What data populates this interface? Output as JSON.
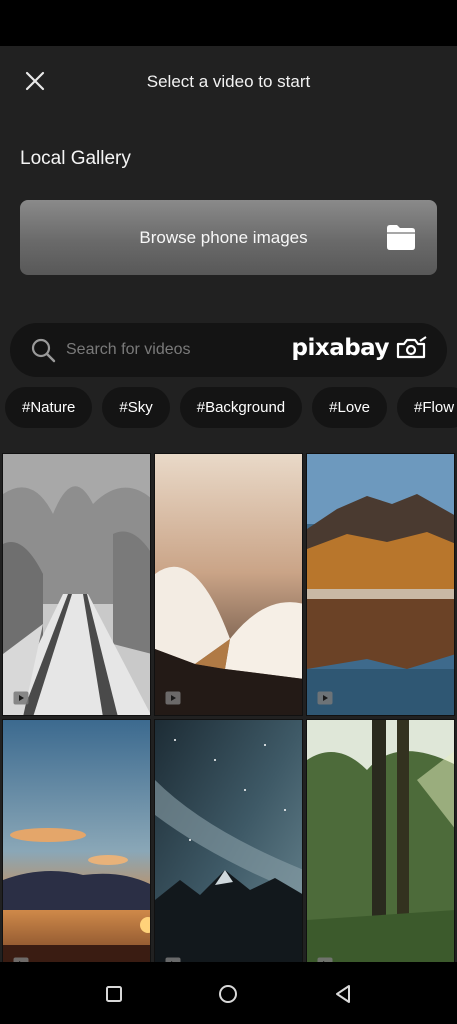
{
  "header": {
    "title": "Select a video to start",
    "close_icon": "close-icon"
  },
  "gallery": {
    "section_title": "Local Gallery",
    "browse_label": "Browse phone images",
    "browse_icon": "folder-icon"
  },
  "search": {
    "placeholder": "Search for videos",
    "brand": "pixabay",
    "search_icon": "search-icon",
    "brand_icon": "camera-icon"
  },
  "tags": [
    "#Nature",
    "#Sky",
    "#Background",
    "#Love",
    "#Flow"
  ],
  "videos": [
    {
      "subject": "snowy forest road",
      "badge_icon": "video-icon"
    },
    {
      "subject": "open book at sunset",
      "badge_icon": "video-icon"
    },
    {
      "subject": "autumn mountain lake",
      "badge_icon": "video-icon"
    },
    {
      "subject": "sunset clouds",
      "badge_icon": "video-icon"
    },
    {
      "subject": "starry night mountains",
      "badge_icon": "video-icon"
    },
    {
      "subject": "green forest",
      "badge_icon": "video-icon"
    }
  ],
  "colors": {
    "sheet_background": "#212121",
    "button_gradient_top": "#8a8a8a",
    "pill_background": "#141414"
  },
  "nav": {
    "recents_icon": "square-icon",
    "home_icon": "circle-icon",
    "back_icon": "triangle-back-icon"
  }
}
